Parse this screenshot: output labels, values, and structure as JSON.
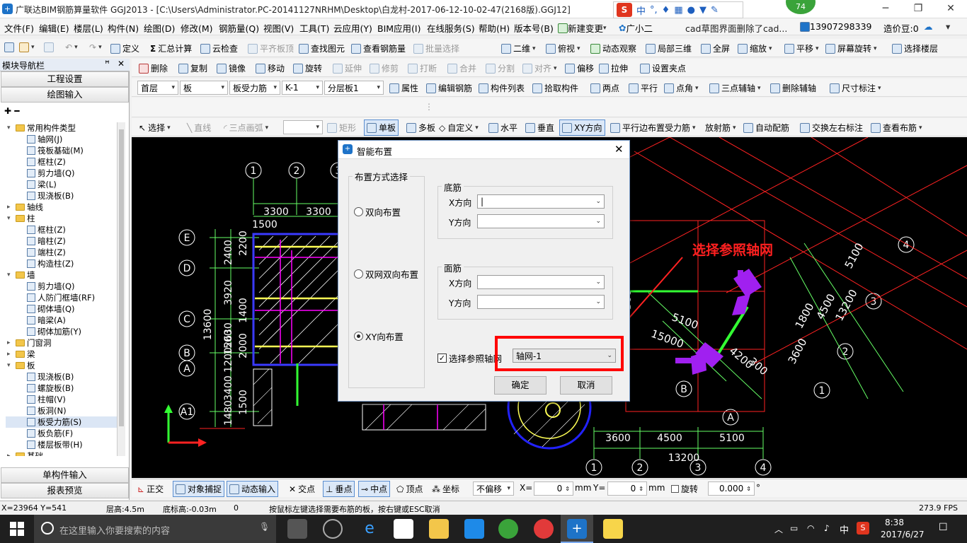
{
  "window": {
    "title": "广联达BIM钢筋算量软件 GGJ2013 - [C:\\Users\\Administrator.PC-20141127NRHM\\Desktop\\白龙村-2017-06-12-10-02-47(2168版).GGJ12]",
    "badge": "74"
  },
  "ime": {
    "label": "中",
    "icons": [
      "s-logo-icon",
      "moon-icon",
      "mic-icon",
      "keyboard-icon",
      "user-icon",
      "shirt-icon",
      "wrench-icon"
    ]
  },
  "menu": [
    "文件(F)",
    "编辑(E)",
    "楼层(L)",
    "构件(N)",
    "绘图(D)",
    "修改(M)",
    "钢筋量(Q)",
    "视图(V)",
    "工具(T)",
    "云应用(Y)",
    "BIM应用(I)",
    "在线服务(S)",
    "帮助(H)",
    "版本号(B)",
    "新建变更",
    "广小二",
    "cad草图界面删除了cad...",
    "13907298339",
    "造价豆:0"
  ],
  "toolbar1": [
    "定义",
    "汇总计算",
    "云检查",
    "平齐板顶",
    "查找图元",
    "查看钢筋量",
    "批量选择",
    "二维",
    "俯视",
    "动态观察",
    "局部三维",
    "全屏",
    "缩放",
    "平移",
    "屏幕旋转",
    "选择楼层"
  ],
  "toolbar2": [
    "删除",
    "复制",
    "镜像",
    "移动",
    "旋转",
    "延伸",
    "修剪",
    "打断",
    "合并",
    "分割",
    "对齐",
    "偏移",
    "拉伸",
    "设置夹点"
  ],
  "toolbar3": {
    "floor": "首层",
    "type": "板",
    "subtype": "板受力筋",
    "name": "K-1",
    "layer": "分层板1",
    "items": [
      "属性",
      "编辑钢筋",
      "构件列表",
      "拾取构件",
      "两点",
      "平行",
      "点角",
      "三点辅轴",
      "删除辅轴",
      "尺寸标注"
    ]
  },
  "toolbar4": [
    "选择",
    "直线",
    "三点画弧",
    "矩形",
    "单板",
    "多板",
    "自定义",
    "水平",
    "垂直",
    "XY方向",
    "平行边布置受力筋",
    "放射筋",
    "自动配筋",
    "交换左右标注",
    "查看布筋"
  ],
  "panel": {
    "title": "模块导航栏",
    "btn_setup": "工程设置",
    "btn_draw": "绘图输入",
    "tree": [
      {
        "label": "常用构件类型",
        "level": 0,
        "kind": "folder",
        "exp": "▾"
      },
      {
        "label": "轴网(J)",
        "level": 1,
        "kind": "leaf"
      },
      {
        "label": "筏板基础(M)",
        "level": 1,
        "kind": "leaf"
      },
      {
        "label": "框柱(Z)",
        "level": 1,
        "kind": "leaf"
      },
      {
        "label": "剪力墙(Q)",
        "level": 1,
        "kind": "leaf"
      },
      {
        "label": "梁(L)",
        "level": 1,
        "kind": "leaf"
      },
      {
        "label": "现浇板(B)",
        "level": 1,
        "kind": "leaf"
      },
      {
        "label": "轴线",
        "level": 0,
        "kind": "folder",
        "exp": "▸"
      },
      {
        "label": "柱",
        "level": 0,
        "kind": "folder",
        "exp": "▾"
      },
      {
        "label": "框柱(Z)",
        "level": 1,
        "kind": "leaf"
      },
      {
        "label": "暗柱(Z)",
        "level": 1,
        "kind": "leaf"
      },
      {
        "label": "端柱(Z)",
        "level": 1,
        "kind": "leaf"
      },
      {
        "label": "构造柱(Z)",
        "level": 1,
        "kind": "leaf"
      },
      {
        "label": "墙",
        "level": 0,
        "kind": "folder",
        "exp": "▾"
      },
      {
        "label": "剪力墙(Q)",
        "level": 1,
        "kind": "leaf"
      },
      {
        "label": "人防门框墙(RF)",
        "level": 1,
        "kind": "leaf"
      },
      {
        "label": "砌体墙(Q)",
        "level": 1,
        "kind": "leaf"
      },
      {
        "label": "暗梁(A)",
        "level": 1,
        "kind": "leaf"
      },
      {
        "label": "砌体加筋(Y)",
        "level": 1,
        "kind": "leaf"
      },
      {
        "label": "门窗洞",
        "level": 0,
        "kind": "folder",
        "exp": "▸"
      },
      {
        "label": "梁",
        "level": 0,
        "kind": "folder",
        "exp": "▸"
      },
      {
        "label": "板",
        "level": 0,
        "kind": "folder",
        "exp": "▾"
      },
      {
        "label": "现浇板(B)",
        "level": 1,
        "kind": "leaf"
      },
      {
        "label": "螺旋板(B)",
        "level": 1,
        "kind": "leaf"
      },
      {
        "label": "柱帽(V)",
        "level": 1,
        "kind": "leaf"
      },
      {
        "label": "板洞(N)",
        "level": 1,
        "kind": "leaf"
      },
      {
        "label": "板受力筋(S)",
        "level": 1,
        "kind": "leaf",
        "selected": true
      },
      {
        "label": "板负筋(F)",
        "level": 1,
        "kind": "leaf"
      },
      {
        "label": "楼层板带(H)",
        "level": 1,
        "kind": "leaf"
      },
      {
        "label": "基础",
        "level": 0,
        "kind": "folder",
        "exp": "▸"
      }
    ],
    "btn_single": "单构件输入",
    "btn_report": "报表预览"
  },
  "dialog": {
    "title": "智能布置",
    "group_mode": "布置方式选择",
    "modes": [
      {
        "label": "双向布置",
        "checked": false
      },
      {
        "label": "双网双向布置",
        "checked": false
      },
      {
        "label": "XY向布置",
        "checked": true
      }
    ],
    "group_bottom": "底筋",
    "group_top": "面筋",
    "x_label": "X方向",
    "y_label": "Y方向",
    "checkbox_label": "选择参照轴网",
    "axis_value": "轴网-1",
    "ok": "确定",
    "cancel": "取消"
  },
  "annotation": {
    "text": "选择参照轴网",
    "color": "#ff2020"
  },
  "drawing": {
    "axis_left": [
      "1",
      "2",
      "3"
    ],
    "axis_rows": [
      "E",
      "D",
      "C",
      "B",
      "A",
      "A1"
    ],
    "dims_top": [
      "3300",
      "3300",
      "1500"
    ],
    "dims_left": [
      "2400",
      "3920",
      "13600",
      "2630",
      "1500",
      "1200",
      "3400",
      "1480"
    ],
    "dims_left2": [
      "2200",
      "1400",
      "2000",
      "1500"
    ],
    "axis_bottom": [
      "1",
      "2",
      "3",
      "4"
    ],
    "dims_bottom": [
      "3600",
      "4500",
      "5100",
      "13200"
    ],
    "rotated_labels": [
      "5100",
      "15000",
      "4200",
      "300",
      "1800",
      "4500",
      "13200",
      "3600",
      "5100"
    ],
    "rotated_axes": [
      "4",
      "3",
      "2",
      "1",
      "B",
      "A"
    ]
  },
  "snap": {
    "items": [
      "正交",
      "对象捕捉",
      "动态输入",
      "交点",
      "垂点",
      "中点",
      "顶点",
      "坐标"
    ],
    "offset": "不偏移",
    "x_label": "X=",
    "x_value": "0",
    "unit": "mm",
    "y_label": "Y=",
    "y_value": "0",
    "rotate_label": "旋转",
    "rotate_value": "0.000"
  },
  "status": {
    "coords": "X=23964 Y=541",
    "floor_h": "层高:4.5m",
    "base_h": "底标高:-0.03m",
    "zero": "0",
    "hint": "按鼠标左键选择需要布筋的板，按右键或ESC取消",
    "fps": "273.9 FPS"
  },
  "taskbar": {
    "search_placeholder": "在这里输入你要搜索的内容",
    "time": "8:38",
    "date": "2017/6/27",
    "lang": "中"
  },
  "colors": {
    "accent": "#1e73c8",
    "cad_bg": "#000000",
    "highlight_box": "#ff0000"
  }
}
